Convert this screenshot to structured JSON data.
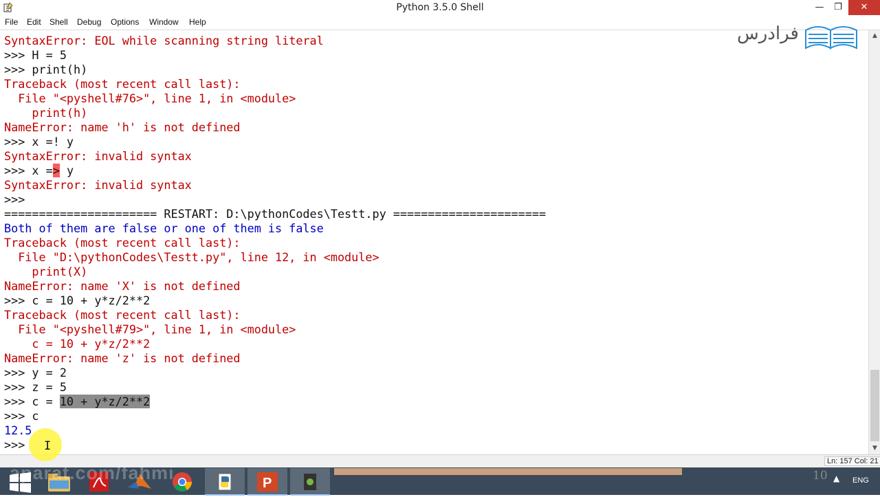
{
  "window": {
    "title": "Python 3.5.0 Shell",
    "controls": {
      "minimize": "—",
      "maximize": "❐",
      "close": "✕"
    }
  },
  "menu": {
    "items": [
      "File",
      "Edit",
      "Shell",
      "Debug",
      "Options",
      "Window",
      "Help"
    ]
  },
  "shell": {
    "lines": [
      {
        "kind": "error",
        "text": "SyntaxError: EOL while scanning string literal"
      },
      {
        "kind": "prompt",
        "text": ">>> H = 5"
      },
      {
        "kind": "prompt",
        "text": ">>> print(h)"
      },
      {
        "kind": "error",
        "text": "Traceback (most recent call last):"
      },
      {
        "kind": "error",
        "text": "  File \"<pyshell#76>\", line 1, in <module>"
      },
      {
        "kind": "error",
        "text": "    print(h)"
      },
      {
        "kind": "error",
        "text": "NameError: name 'h' is not defined"
      },
      {
        "kind": "prompt",
        "text": ">>> x =! y"
      },
      {
        "kind": "error",
        "text": "SyntaxError: invalid syntax"
      },
      {
        "kind": "prompt_marked",
        "before": ">>> x =",
        "mark": ">",
        "after": " y"
      },
      {
        "kind": "error",
        "text": "SyntaxError: invalid syntax"
      },
      {
        "kind": "prompt",
        "text": ">>> "
      },
      {
        "kind": "prompt",
        "text": "====================== RESTART: D:\\pythonCodes\\Testt.py ======================"
      },
      {
        "kind": "out",
        "text": "Both of them are false or one of them is false"
      },
      {
        "kind": "error",
        "text": "Traceback (most recent call last):"
      },
      {
        "kind": "error",
        "text": "  File \"D:\\pythonCodes\\Testt.py\", line 12, in <module>"
      },
      {
        "kind": "error",
        "text": "    print(X)"
      },
      {
        "kind": "error",
        "text": "NameError: name 'X' is not defined"
      },
      {
        "kind": "prompt",
        "text": ">>> c = 10 + y*z/2**2"
      },
      {
        "kind": "error",
        "text": "Traceback (most recent call last):"
      },
      {
        "kind": "error",
        "text": "  File \"<pyshell#79>\", line 1, in <module>"
      },
      {
        "kind": "error",
        "text": "    c = 10 + y*z/2**2"
      },
      {
        "kind": "error",
        "text": "NameError: name 'z' is not defined"
      },
      {
        "kind": "prompt",
        "text": ">>> y = 2"
      },
      {
        "kind": "prompt",
        "text": ">>> z = 5"
      },
      {
        "kind": "prompt_selected",
        "before": ">>> c = ",
        "selected": "10 + y*z/2**2",
        "after": ""
      },
      {
        "kind": "prompt",
        "text": ">>> c"
      },
      {
        "kind": "out",
        "text": "12.5"
      },
      {
        "kind": "prompt",
        "text": ">>> "
      }
    ]
  },
  "status": {
    "text": "Ln: 157 Col: 21"
  },
  "logo": {
    "text": "فرادرس"
  },
  "watermark": {
    "text": "aparat.com/fahmi"
  },
  "taskbar": {
    "apps": [
      "windows-start",
      "file-explorer",
      "acrobat",
      "matlab",
      "chrome",
      "python",
      "powerpoint",
      "media-app"
    ],
    "tray_number": "10",
    "language": "ENG"
  },
  "colors": {
    "error": "#c00000",
    "output": "#0000c0",
    "selection": "#8c8c8c",
    "close_button": "#c7372f",
    "taskbar": "#3a4a5a"
  }
}
